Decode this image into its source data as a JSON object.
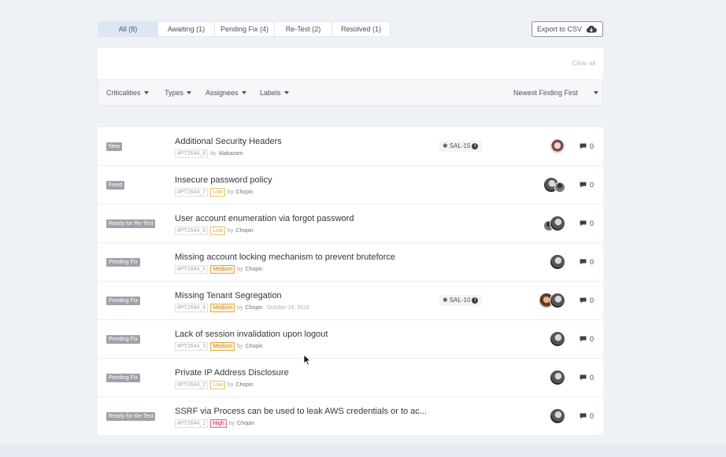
{
  "tabs": [
    {
      "label": "All (8)",
      "active": true
    },
    {
      "label": "Awaiting (1)"
    },
    {
      "label": "Pending Fix (4)"
    },
    {
      "label": "Re-Test (2)"
    },
    {
      "label": "Resolved (1)"
    }
  ],
  "export_label": "Export to CSV",
  "clear_all": "Clear all",
  "filters": {
    "criticalities": "Criticalities",
    "types": "Types",
    "assignees": "Assignees",
    "labels": "Labels",
    "sort": "Newest Finding First"
  },
  "findings": [
    {
      "status": "New",
      "title": "Additional Security Headers",
      "id": "#PT2644_8",
      "criticality": "",
      "by_prefix": "by",
      "author": "Alakazam",
      "date": "",
      "tag": "SAL-15",
      "comments": "0"
    },
    {
      "status": "Fixed",
      "title": "Insecure password policy",
      "id": "#PT2644_7",
      "criticality": "Low",
      "by_prefix": "by",
      "author": "Chopin",
      "date": "",
      "tag": "",
      "comments": "0"
    },
    {
      "status": "Ready for Re-Test",
      "title": "User account enumeration via forgot password",
      "id": "#PT2644_6",
      "criticality": "Low",
      "by_prefix": "by",
      "author": "Chopin",
      "date": "",
      "tag": "",
      "comments": "0"
    },
    {
      "status": "Pending Fix",
      "title": "Missing account locking mechanism to prevent bruteforce",
      "id": "#PT2644_5",
      "criticality": "Medium",
      "by_prefix": "by",
      "author": "Chopin",
      "date": "",
      "tag": "",
      "comments": "0"
    },
    {
      "status": "Pending Fix",
      "title": "Missing Tenant Segregation",
      "id": "#PT2644_4",
      "criticality": "Medium",
      "by_prefix": "by",
      "author": "Chopin",
      "date": "October 16, 2019",
      "tag": "SAL-10",
      "comments": "0"
    },
    {
      "status": "Pending Fix",
      "title": "Lack of session invalidation upon logout",
      "id": "#PT2644_3",
      "criticality": "Medium",
      "by_prefix": "by",
      "author": "Chopin",
      "date": "",
      "tag": "",
      "comments": "0"
    },
    {
      "status": "Pending Fix",
      "title": "Private IP Address Disclosure",
      "id": "#PT2644_2",
      "criticality": "Low",
      "by_prefix": "by",
      "author": "Chopin",
      "date": "",
      "tag": "",
      "comments": "0"
    },
    {
      "status": "Ready for Re-Test",
      "title": "SSRF via Process can be used to leak AWS credentials or to ac...",
      "id": "#PT2644_1",
      "criticality": "High",
      "by_prefix": "by",
      "author": "Chopin",
      "date": "",
      "tag": "",
      "comments": "0"
    }
  ],
  "colors": {
    "active_tab": "#dde7f3",
    "status_badge": "#9ea2a9",
    "low": "#e0ac3a",
    "high": "#d63a5a"
  }
}
